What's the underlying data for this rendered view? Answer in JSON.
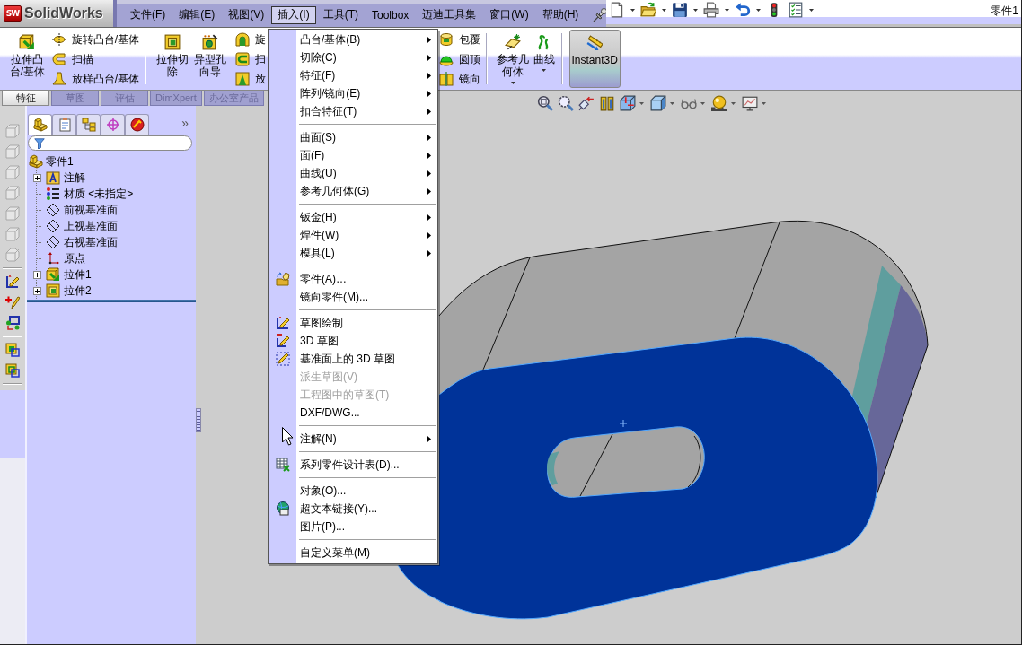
{
  "app": {
    "logo_badge": "SW",
    "logo_text": "SolidWorks",
    "document_title": "零件1"
  },
  "menu_bar": [
    {
      "label": "文件(F)",
      "selected": false
    },
    {
      "label": "编辑(E)",
      "selected": false
    },
    {
      "label": "视图(V)",
      "selected": false
    },
    {
      "label": "插入(I)",
      "selected": true
    },
    {
      "label": "工具(T)",
      "selected": false
    },
    {
      "label": "Toolbox",
      "selected": false
    },
    {
      "label": "迈迪工具集",
      "selected": false
    },
    {
      "label": "窗口(W)",
      "selected": false
    },
    {
      "label": "帮助(H)",
      "selected": false
    }
  ],
  "command_manager": {
    "groups": [
      [
        {
          "kind": "large",
          "label": "拉伸凸台/基体",
          "dropdown": false,
          "pressed": false
        },
        {
          "kind": "stack",
          "items": [
            "旋转凸台/基体",
            "扫描",
            "放样凸台/基体"
          ]
        }
      ],
      [
        {
          "kind": "large",
          "label": "拉伸切除",
          "dropdown": false,
          "pressed": false
        },
        {
          "kind": "large",
          "label": "异型孔向导",
          "dropdown": false,
          "pressed": false
        },
        {
          "kind": "stack",
          "items": [
            "旋",
            "扫",
            "放"
          ]
        }
      ],
      [
        {
          "kind": "stack",
          "items": [
            "包覆",
            "圆顶",
            "镜向"
          ]
        }
      ],
      [
        {
          "kind": "large",
          "label": "参考几何体",
          "dropdown": true,
          "pressed": false
        },
        {
          "kind": "large",
          "label": "曲线",
          "dropdown": true,
          "pressed": false
        }
      ],
      [
        {
          "kind": "large",
          "label": "Instant3D",
          "dropdown": false,
          "pressed": true
        }
      ]
    ],
    "tabs": [
      {
        "label": "特征",
        "selected": true
      },
      {
        "label": "草图",
        "selected": false
      },
      {
        "label": "评估",
        "selected": false
      },
      {
        "label": "DimXpert",
        "selected": false
      },
      {
        "label": "办公室产品",
        "selected": false
      }
    ]
  },
  "feature_manager": {
    "tabs": [
      {
        "selected": true
      },
      {
        "selected": false
      },
      {
        "selected": false
      },
      {
        "selected": false
      },
      {
        "selected": false
      }
    ],
    "more": "»",
    "tree": {
      "label": "零件1",
      "children": [
        {
          "label": "注解",
          "kind": "annotations",
          "collapsed": true
        },
        {
          "label": "材质 <未指定>",
          "kind": "material",
          "collapsed": false
        },
        {
          "label": "前视基准面",
          "kind": "plane",
          "collapsed": false
        },
        {
          "label": "上视基准面",
          "kind": "plane",
          "collapsed": false
        },
        {
          "label": "右视基准面",
          "kind": "plane",
          "collapsed": false
        },
        {
          "label": "原点",
          "kind": "origin",
          "collapsed": false
        },
        {
          "label": "拉伸1",
          "kind": "boss",
          "collapsed": true
        },
        {
          "label": "拉伸2",
          "kind": "cut",
          "collapsed": true
        }
      ]
    }
  },
  "insert_menu": {
    "groups": [
      [
        {
          "label": "凸台/基体(B)",
          "submenu": true,
          "disabled": false
        },
        {
          "label": "切除(C)",
          "submenu": true,
          "disabled": false
        },
        {
          "label": "特征(F)",
          "submenu": true,
          "disabled": false
        },
        {
          "label": "阵列/镜向(E)",
          "submenu": true,
          "disabled": false
        },
        {
          "label": "扣合特征(T)",
          "submenu": true,
          "disabled": false
        }
      ],
      [
        {
          "label": "曲面(S)",
          "submenu": true,
          "disabled": false
        },
        {
          "label": "面(F)",
          "submenu": true,
          "disabled": false
        },
        {
          "label": "曲线(U)",
          "submenu": true,
          "disabled": false
        },
        {
          "label": "参考几何体(G)",
          "submenu": true,
          "disabled": false
        }
      ],
      [
        {
          "label": "钣金(H)",
          "submenu": true,
          "disabled": false
        },
        {
          "label": "焊件(W)",
          "submenu": true,
          "disabled": false
        },
        {
          "label": "模具(L)",
          "submenu": true,
          "disabled": false
        }
      ],
      [
        {
          "label": "零件(A)…",
          "submenu": false,
          "disabled": false
        },
        {
          "label": "镜向零件(M)...",
          "submenu": false,
          "disabled": false
        }
      ],
      [
        {
          "label": "草图绘制",
          "submenu": false,
          "disabled": false
        },
        {
          "label": "3D 草图",
          "submenu": false,
          "disabled": false
        },
        {
          "label": "基准面上的 3D 草图",
          "submenu": false,
          "disabled": false
        },
        {
          "label": "派生草图(V)",
          "submenu": false,
          "disabled": true
        },
        {
          "label": "工程图中的草图(T)",
          "submenu": false,
          "disabled": true
        },
        {
          "label": "DXF/DWG...",
          "submenu": false,
          "disabled": false
        }
      ],
      [
        {
          "label": "注解(N)",
          "submenu": true,
          "disabled": false
        }
      ],
      [
        {
          "label": "系列零件设计表(D)...",
          "submenu": false,
          "disabled": false
        }
      ],
      [
        {
          "label": "对象(O)...",
          "submenu": false,
          "disabled": false
        },
        {
          "label": "超文本链接(Y)...",
          "submenu": false,
          "disabled": false
        },
        {
          "label": "图片(P)...",
          "submenu": false,
          "disabled": false
        }
      ],
      [
        {
          "label": "自定义菜单(M)",
          "submenu": false,
          "disabled": false
        }
      ]
    ]
  }
}
